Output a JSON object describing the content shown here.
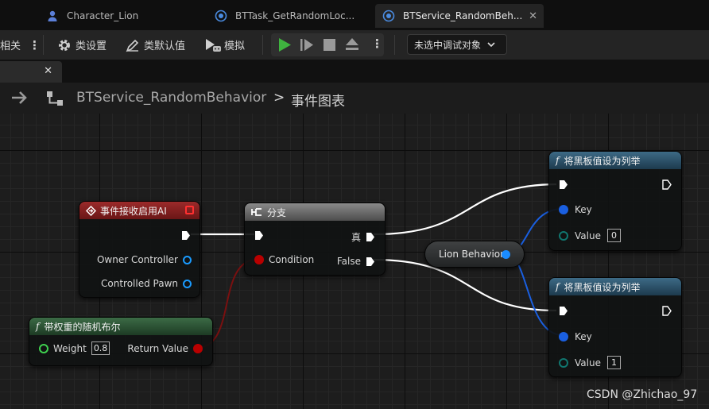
{
  "tabs": [
    {
      "label": "Character_Lion",
      "active": false
    },
    {
      "label": "BTTask_GetRandomLoc...",
      "active": false
    },
    {
      "label": "BTService_RandomBeh...",
      "active": true
    }
  ],
  "toolbar": {
    "related_label": "相关",
    "class_settings_label": "类设置",
    "class_defaults_label": "类默认值",
    "simulate_label": "模拟",
    "debug_object_label": "未选中调试对象"
  },
  "breadcrumb": {
    "root": "BTService_RandomBehavior",
    "separator": ">",
    "current": "事件图表"
  },
  "nodes": {
    "event": {
      "title": "事件接收启用AI",
      "owner_controller": "Owner Controller",
      "controlled_pawn": "Controlled Pawn"
    },
    "branch": {
      "title": "分支",
      "true_label": "真",
      "condition_label": "Condition",
      "false_label": "False"
    },
    "random_bool": {
      "title": "带权重的随机布尔",
      "weight_label": "Weight",
      "weight_value": "0.8",
      "return_label": "Return Value"
    },
    "variable": {
      "label": "Lion Behavior"
    },
    "set_enum_1": {
      "title": "将黑板值设为列举",
      "key_label": "Key",
      "value_label": "Value",
      "value": "0"
    },
    "set_enum_2": {
      "title": "将黑板值设为列举",
      "key_label": "Key",
      "value_label": "Value",
      "value": "1"
    }
  },
  "watermark": "CSDN @Zhichao_97",
  "colors": {
    "exec_pin": "#ffffff",
    "bool_pin": "#b90000",
    "object_pin": "#1a9bff",
    "key_pin": "#1a5fe0",
    "enum_pin": "#10766f",
    "event_header": "#8e2424",
    "function_header": "#2f5a38",
    "blackboard_header": "#345a73"
  },
  "icons": {
    "tab1": "character-icon",
    "tab2": "blueprint-icon",
    "tab3": "blueprint-icon",
    "play": "play-icon",
    "step": "step-icon",
    "stop": "stop-icon",
    "eject": "eject-icon"
  }
}
